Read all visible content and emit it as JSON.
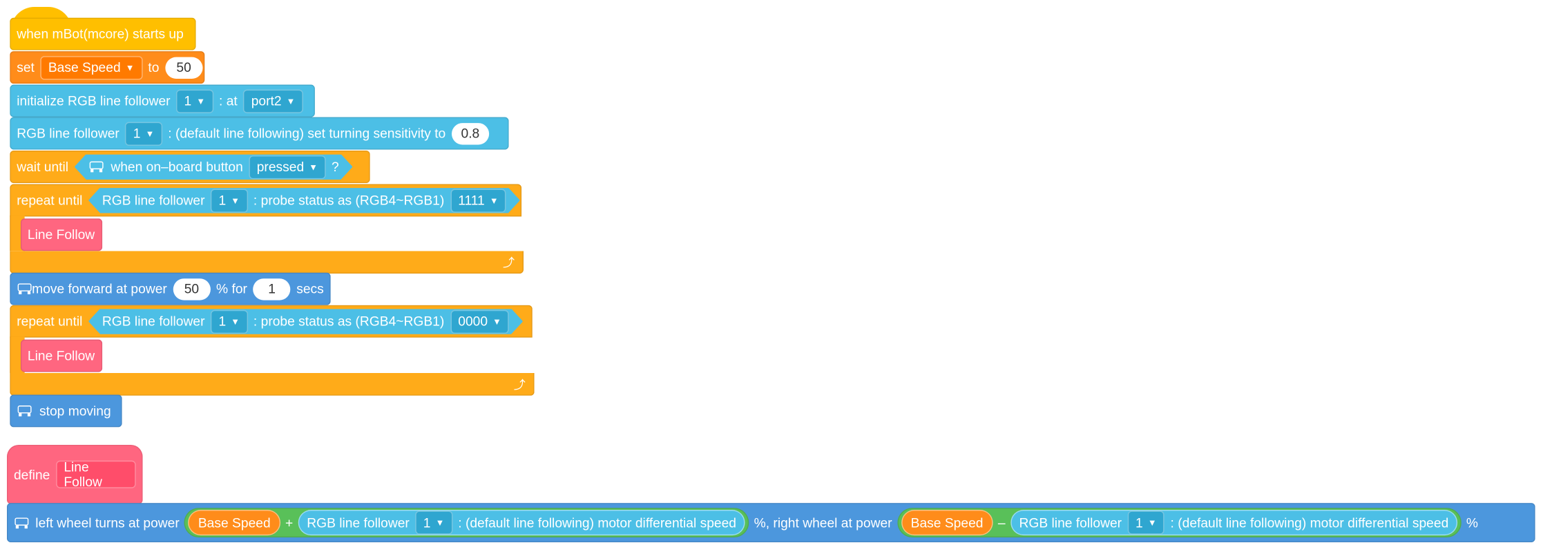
{
  "start_script": {
    "hat_label": "when mBot(mcore) starts up",
    "set_block": {
      "label": "set",
      "variable": "Base Speed",
      "to": "to",
      "value": "50"
    },
    "init_block": {
      "label": "initialize RGB line follower",
      "id": "1",
      "at": ": at",
      "port": "port2"
    },
    "sensitivity_block": {
      "label": "RGB line follower",
      "id": "1",
      "text": ": (default line following) set turning sensitivity to",
      "value": "0.8"
    },
    "wait_block": {
      "label": "wait until",
      "condition_text": "when on–board button",
      "state": "pressed",
      "question": "?"
    },
    "repeat1": {
      "label": "repeat until",
      "sensor": "RGB line follower",
      "id": "1",
      "text": ": probe status as (RGB4~RGB1)",
      "pattern": "1111",
      "body_label": "Line Follow"
    },
    "move_block": {
      "prefix": "move forward at power",
      "power": "50",
      "middle": "% for",
      "secs": "1",
      "suffix": "secs"
    },
    "repeat2": {
      "label": "repeat until",
      "sensor": "RGB line follower",
      "id": "1",
      "text": ": probe status as (RGB4~RGB1)",
      "pattern": "0000",
      "body_label": "Line Follow"
    },
    "stop_block": {
      "label": "stop moving"
    }
  },
  "define_script": {
    "define_label": "define",
    "proc_name": "Line Follow",
    "wheels_block": {
      "prefix": "left wheel turns at power",
      "left_var": "Base Speed",
      "left_op": "+",
      "sensor": "RGB line follower",
      "id": "1",
      "sensor_text": ": (default line following) motor differential speed",
      "mid_text": "%,  right wheel at power",
      "right_var": "Base Speed",
      "right_op": "–",
      "suffix": "%"
    }
  },
  "colors": {
    "event": "#FFBF00",
    "variable": "#FF8C1A",
    "extension": "#4CBFE6",
    "control": "#FFAB19",
    "motion": "#4C97DD",
    "procedure": "#FF6680",
    "operator": "#59C059"
  },
  "icons": {
    "robot": "mbot-icon",
    "loop": "loop-arrow-icon",
    "dropdown": "caret-down-icon"
  }
}
